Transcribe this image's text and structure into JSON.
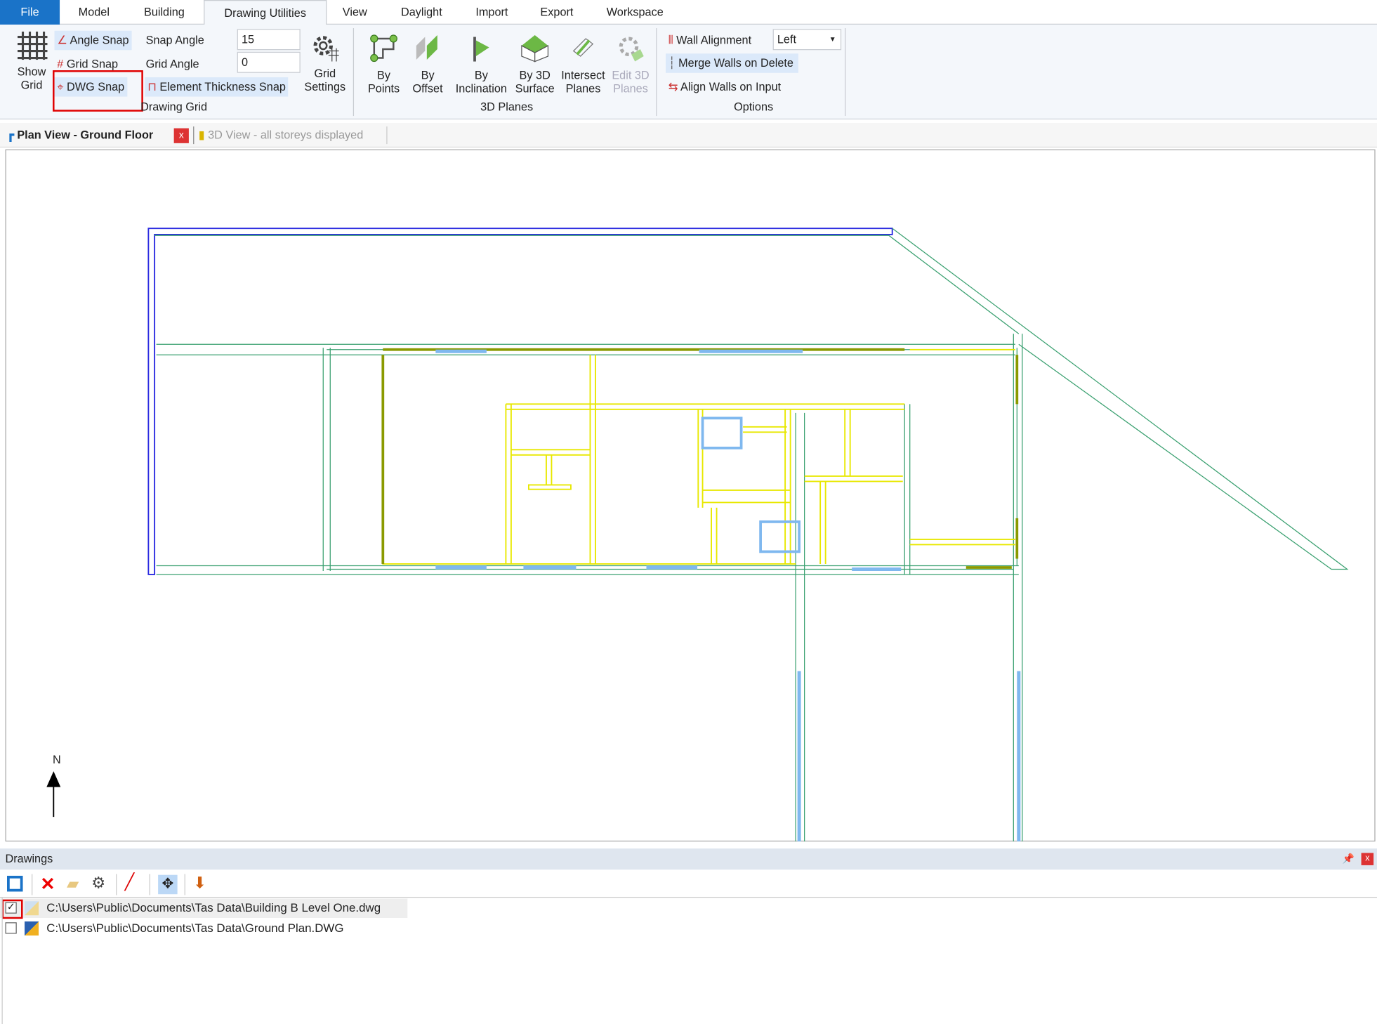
{
  "menu_tabs": [
    "File",
    "Model",
    "Building",
    "Drawing Utilities",
    "View",
    "Daylight",
    "Import",
    "Export",
    "Workspace"
  ],
  "active_tab": "Drawing Utilities",
  "ribbon": {
    "show_grid": [
      "Show",
      "Grid"
    ],
    "angle_snap": "Angle Snap",
    "grid_snap": "Grid Snap",
    "dwg_snap": "DWG Snap",
    "snap_angle_label": "Snap Angle",
    "snap_angle_value": "15",
    "grid_angle_label": "Grid  Angle",
    "grid_angle_value": "0",
    "element_thickness_snap": "Element Thickness Snap",
    "grid_settings": [
      "Grid",
      "Settings"
    ],
    "drawing_grid_group": "Drawing Grid",
    "by_points": [
      "By",
      "Points"
    ],
    "by_offset": [
      "By",
      "Offset"
    ],
    "by_inclination": [
      "By",
      "Inclination"
    ],
    "by_3d_surface": [
      "By 3D",
      "Surface"
    ],
    "intersect_planes": [
      "Intersect",
      "Planes"
    ],
    "edit_3d_planes": [
      "Edit 3D",
      "Planes"
    ],
    "planes_group": "3D Planes",
    "wall_alignment_label": "Wall Alignment",
    "wall_alignment_value": "Left",
    "merge_walls": "Merge Walls on Delete",
    "align_walls": "Align Walls on Input",
    "options_group": "Options"
  },
  "doc_tabs": [
    {
      "label": "Plan View - Ground Floor",
      "active": true,
      "close": "x"
    },
    {
      "label": "3D View - all storeys displayed",
      "active": false
    }
  ],
  "canvas": {
    "north_label": "N"
  },
  "drawings_panel": {
    "title": "Drawings",
    "toolbar_icons": [
      "import-drawing-icon",
      "delete-icon",
      "folder-icon",
      "settings-icon",
      "pen-icon",
      "move-icon",
      "layer-import-icon"
    ],
    "items": [
      {
        "path": "C:\\Users\\Public\\Documents\\Tas Data\\Building B Level One.dwg",
        "checked": true
      },
      {
        "path": "C:\\Users\\Public\\Documents\\Tas Data\\Ground Plan.DWG",
        "checked": false
      }
    ]
  },
  "colors": {
    "file_tab": "#1a73c8",
    "highlight": "#e00000",
    "wall": "#3aa070",
    "dwg": "#e8e800",
    "window": "#7fb8ef",
    "outline": "#2020e0"
  }
}
